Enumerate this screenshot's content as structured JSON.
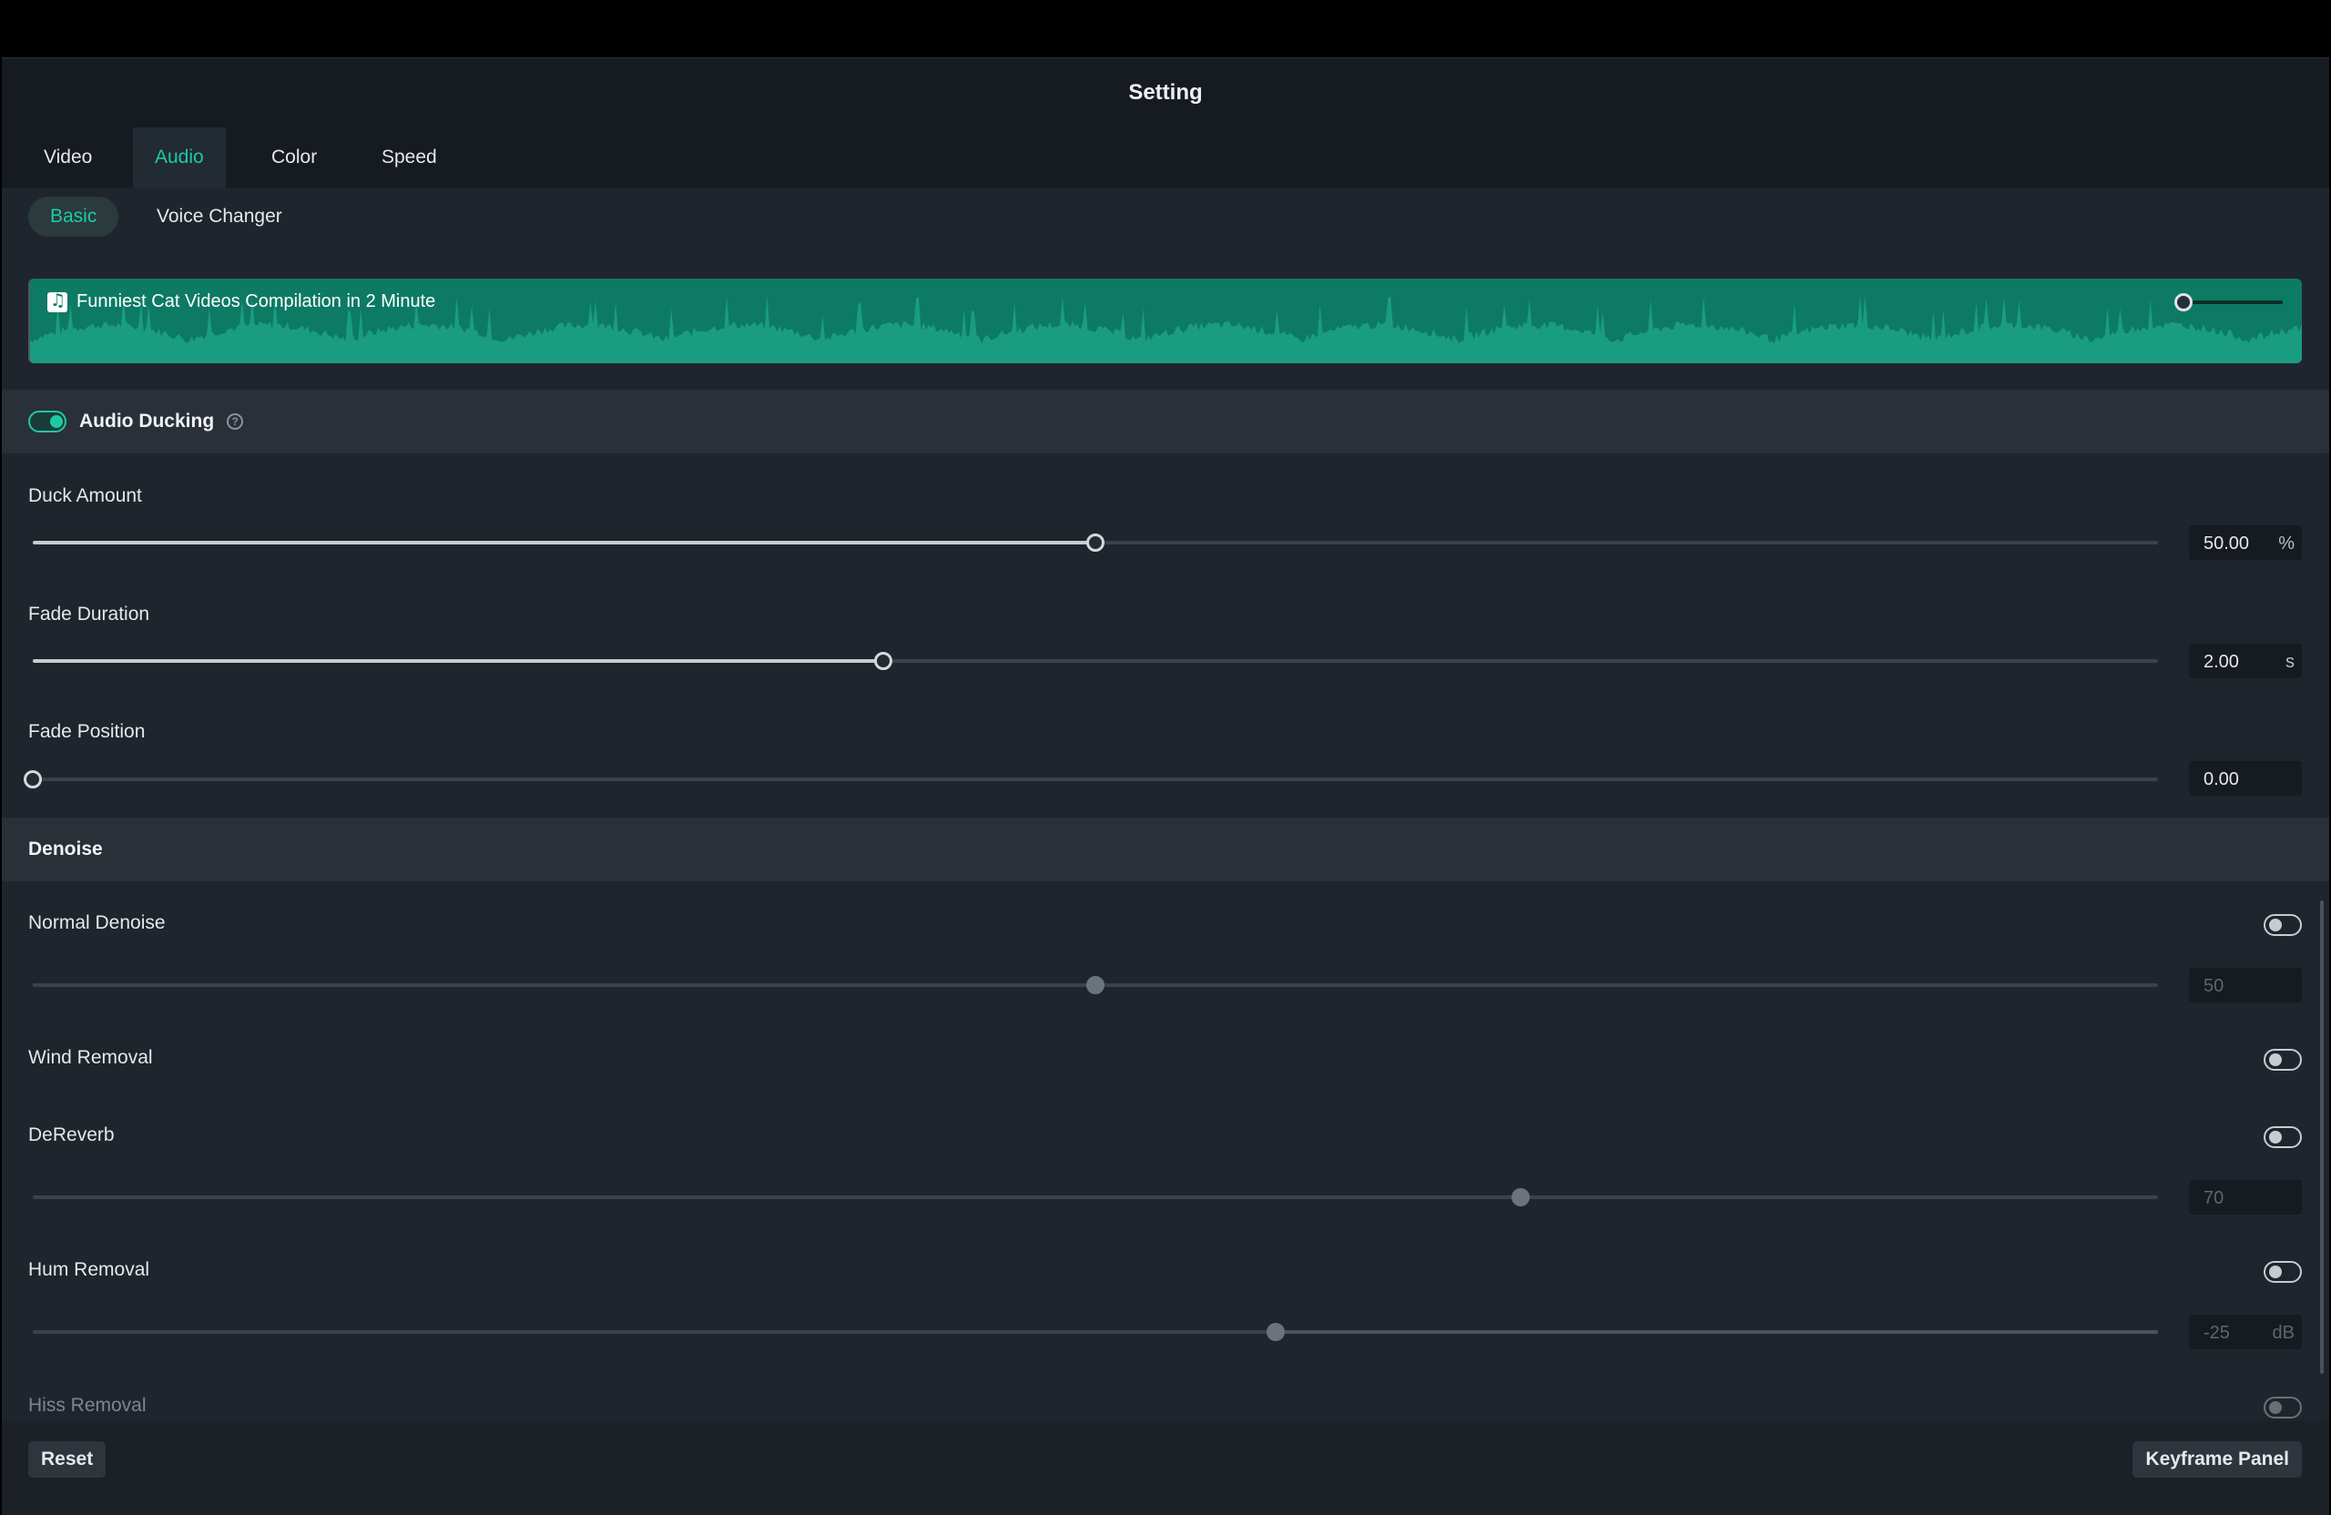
{
  "window": {
    "title": "Setting"
  },
  "tabs": [
    {
      "label": "Video",
      "active": false
    },
    {
      "label": "Audio",
      "active": true
    },
    {
      "label": "Color",
      "active": false
    },
    {
      "label": "Speed",
      "active": false
    }
  ],
  "subtabs": [
    {
      "label": "Basic",
      "active": true
    },
    {
      "label": "Voice Changer",
      "active": false
    }
  ],
  "clip": {
    "title": "Funniest Cat Videos Compilation in 2 Minute",
    "icon": "music-note-icon"
  },
  "audio_ducking": {
    "title": "Audio Ducking",
    "enabled": true,
    "help_icon": "?",
    "duck_amount": {
      "label": "Duck Amount",
      "value": "50.00",
      "unit": "%",
      "fraction": 0.5
    },
    "fade_duration": {
      "label": "Fade Duration",
      "value": "2.00",
      "unit": "s",
      "fraction": 0.4
    },
    "fade_position": {
      "label": "Fade Position",
      "value": "0.00",
      "unit": "",
      "fraction": 0.0
    }
  },
  "denoise": {
    "title": "Denoise",
    "normal": {
      "label": "Normal Denoise",
      "enabled": false,
      "value": "50",
      "unit": "",
      "fraction": 0.5
    },
    "wind": {
      "label": "Wind Removal",
      "enabled": false
    },
    "dereverb": {
      "label": "DeReverb",
      "enabled": false,
      "value": "70",
      "unit": "",
      "fraction": 0.7
    },
    "hum": {
      "label": "Hum Removal",
      "enabled": false,
      "value": "-25",
      "unit": "dB",
      "fraction": 0.585
    },
    "hiss": {
      "label": "Hiss Removal",
      "enabled": false
    }
  },
  "footer": {
    "reset_label": "Reset",
    "keyframe_label": "Keyframe Panel"
  },
  "colors": {
    "accent": "#1ec9a6",
    "waveform": "#0d7a64",
    "background": "#1f252c"
  }
}
